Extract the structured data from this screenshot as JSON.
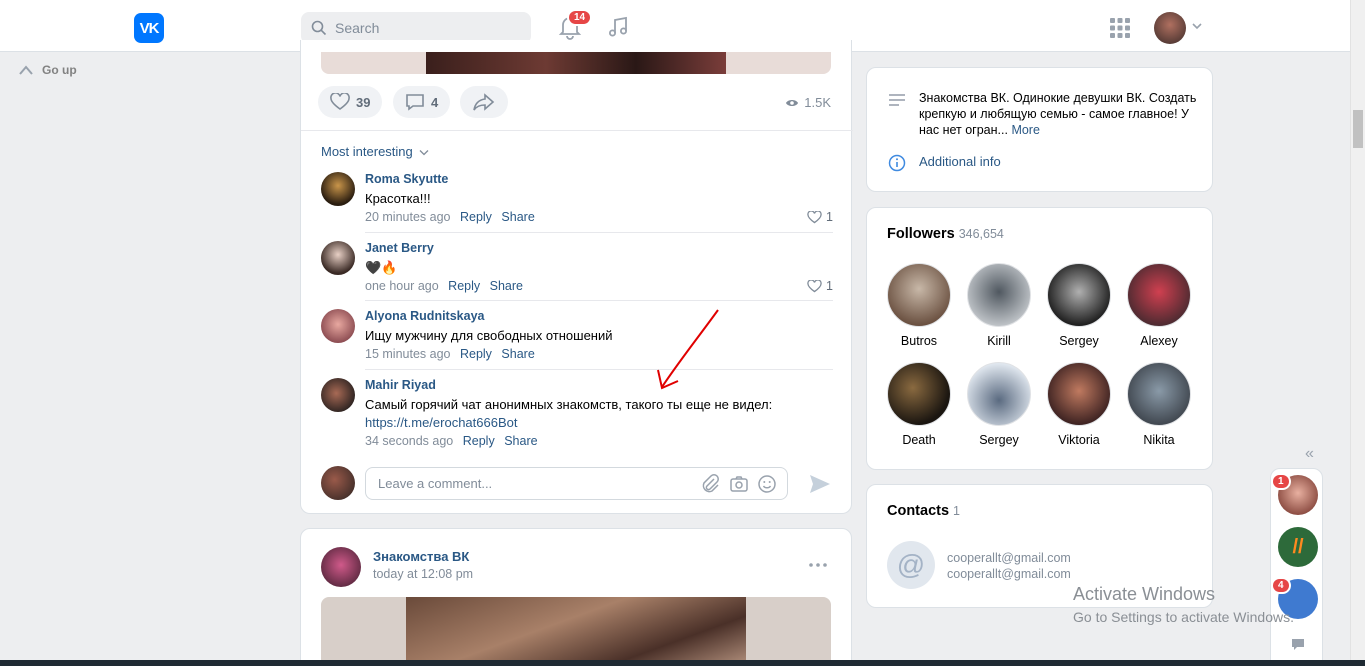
{
  "header": {
    "logo_text": "VK",
    "search_placeholder": "Search",
    "notifications_badge": "14"
  },
  "sidebar": {
    "go_up": "Go up"
  },
  "post1": {
    "likes": "39",
    "comments": "4",
    "views": "1.5K",
    "sort_label": "Most interesting",
    "comments_list": [
      {
        "name": "Roma Skyutte",
        "text": "Красотка!!!",
        "time": "20 minutes ago",
        "reply": "Reply",
        "share": "Share",
        "likes": "1"
      },
      {
        "name": "Janet Berry",
        "text": "🖤🔥",
        "time": "one hour ago",
        "reply": "Reply",
        "share": "Share",
        "likes": "1"
      },
      {
        "name": "Alyona Rudnitskaya",
        "text": "Ищу мужчину для свободных отношений",
        "time": "15 minutes ago",
        "reply": "Reply",
        "share": "Share"
      },
      {
        "name": "Mahir Riyad",
        "text": "Самый горячий чат анонимных знакомств, такого ты еще не видел:",
        "link": "https://t.me/erochat666Bot",
        "time": "34 seconds ago",
        "reply": "Reply",
        "share": "Share"
      }
    ],
    "comment_placeholder": "Leave a comment..."
  },
  "post2": {
    "author": "Знакомства ВК",
    "date": "today at 12:08 pm"
  },
  "info": {
    "description": "Знакомства ВК. Одинокие девушки ВК. Создать крепкую и любящую семью - самое главное! У нас нет огран...",
    "more": "More",
    "additional": "Additional info"
  },
  "followers": {
    "title": "Followers",
    "count": "346,654",
    "people": [
      "Butros",
      "Kirill",
      "Sergey",
      "Alexey",
      "Death",
      "Sergey",
      "Viktoria",
      "Nikita"
    ]
  },
  "contacts": {
    "title": "Contacts",
    "count": "1",
    "email1": "cooperallt@gmail.com",
    "email2": "cooperallt@gmail.com"
  },
  "rail": {
    "badge1": "1",
    "badge2": "4"
  },
  "watermark": {
    "line1": "Activate Windows",
    "line2": "Go to Settings to activate Windows."
  }
}
